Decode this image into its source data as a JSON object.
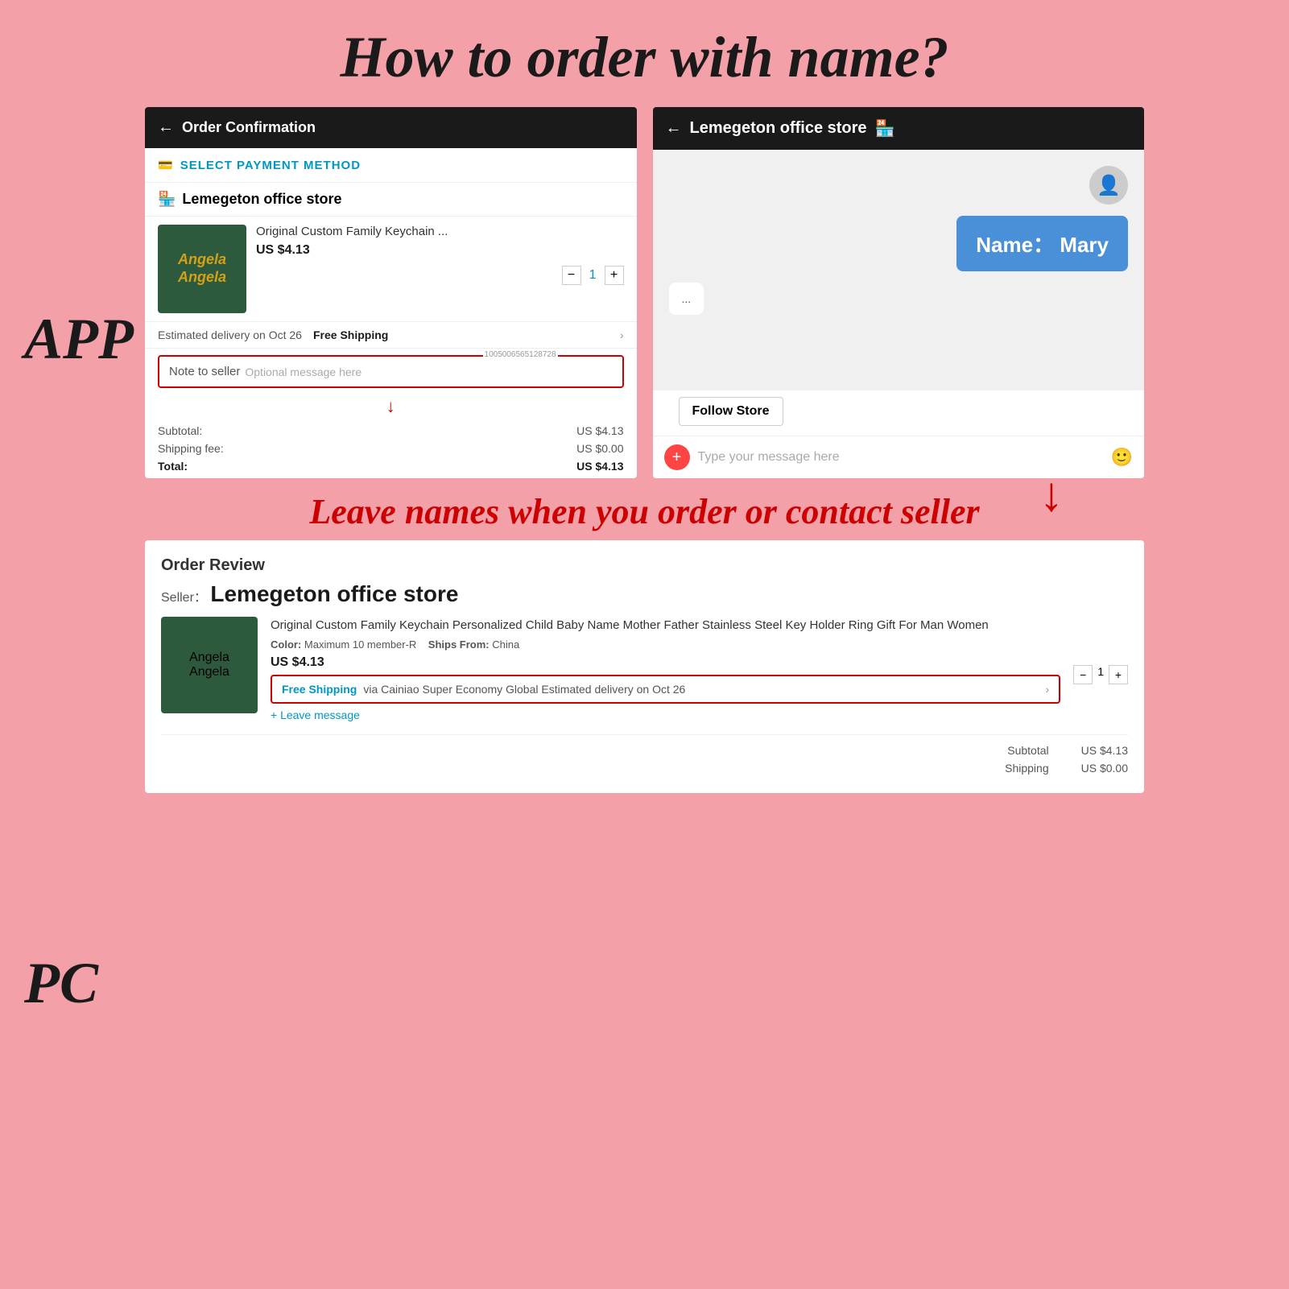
{
  "title": "How to order with name?",
  "label_app": "APP",
  "label_pc": "PC",
  "middle_text": "Leave names when you order or contact seller",
  "app_left": {
    "header_back": "←",
    "header_title": "Order Confirmation",
    "payment_icon": "💳",
    "payment_label": "SELECT PAYMENT METHOD",
    "store_icon": "🏪",
    "store_name": "Lemegeton office store",
    "product_name": "Original Custom Family Keychain ...",
    "product_price": "US $4.13",
    "qty": "1",
    "delivery_text": "Estimated delivery on Oct 26",
    "free_shipping": "Free Shipping",
    "note_label": "Note to seller",
    "note_placeholder": "Optional message here",
    "order_id": "1005006565128728",
    "subtotal_label": "Subtotal:",
    "subtotal_value": "US $4.13",
    "shipping_label": "Shipping fee:",
    "shipping_value": "US $0.00",
    "total_label": "Total:",
    "total_value": "US $4.13",
    "keychain_line1": "Angela",
    "keychain_line2": "Angela"
  },
  "app_right": {
    "header_back": "←",
    "header_title": "Lemegeton office store",
    "store_icon": "🏪",
    "chat_bubble_text": "Name：  Mary",
    "follow_store": "Follow Store",
    "input_placeholder": "Type your message here",
    "plus_icon": "+",
    "emoji_icon": "🙂"
  },
  "pc": {
    "order_review": "Order Review",
    "seller_label": "Seller：",
    "seller_name": "Lemegeton office store",
    "product_name_full": "Original Custom Family Keychain Personalized Child Baby Name Mother Father Stainless Steel Key Holder Ring Gift For Man Women",
    "color_label": "Color:",
    "color_value": "Maximum 10 member-R",
    "ships_from_label": "Ships From:",
    "ships_from_value": "China",
    "product_price": "US $4.13",
    "free_shipping": "Free Shipping",
    "shipping_detail": "via Cainiao Super Economy Global  Estimated delivery on Oct 26",
    "chevron": "›",
    "leave_message": "+ Leave message",
    "qty": "1",
    "subtotal_label": "Subtotal",
    "subtotal_value": "US $4.13",
    "shipping_label": "Shipping",
    "shipping_value": "US $0.00",
    "keychain_line1": "Angela",
    "keychain_line2": "Angela"
  }
}
